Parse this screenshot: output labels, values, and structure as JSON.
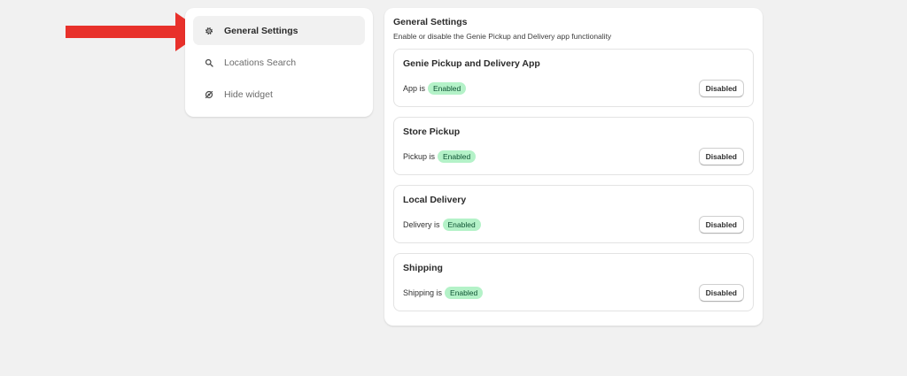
{
  "colors": {
    "arrow": "#e8312b",
    "badge_bg": "#b4f2c8",
    "badge_text": "#0c5132",
    "page_bg": "#f1f1f1"
  },
  "sidebar": {
    "items": [
      {
        "label": "General Settings",
        "icon": "gear-icon",
        "active": true
      },
      {
        "label": "Locations Search",
        "icon": "search-icon",
        "active": false
      },
      {
        "label": "Hide widget",
        "icon": "hide-icon",
        "active": false
      }
    ]
  },
  "main": {
    "title": "General Settings",
    "description": "Enable or disable the Genie Pickup and Delivery app functionality",
    "settings": [
      {
        "title": "Genie Pickup and Delivery App",
        "status_label": "App is",
        "status": "Enabled",
        "button": "Disabled"
      },
      {
        "title": "Store Pickup",
        "status_label": "Pickup is",
        "status": "Enabled",
        "button": "Disabled"
      },
      {
        "title": "Local Delivery",
        "status_label": "Delivery is",
        "status": "Enabled",
        "button": "Disabled"
      },
      {
        "title": "Shipping",
        "status_label": "Shipping is",
        "status": "Enabled",
        "button": "Disabled"
      }
    ]
  }
}
